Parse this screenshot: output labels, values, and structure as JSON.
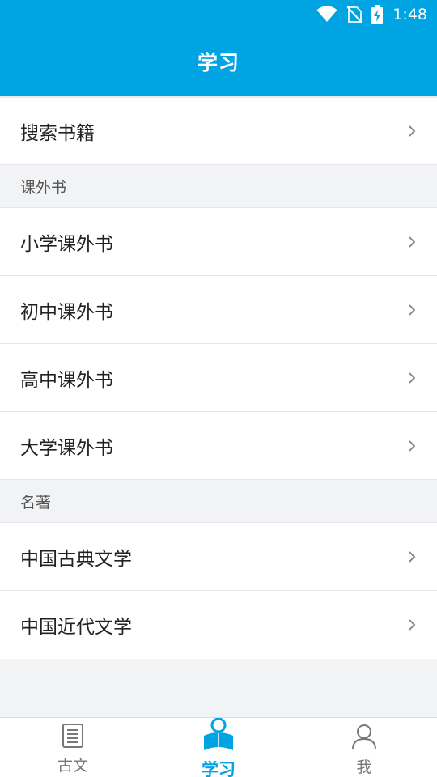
{
  "status_bar": {
    "time": "1:48"
  },
  "header": {
    "title": "学习"
  },
  "search_row": {
    "label": "搜索书籍"
  },
  "sections": [
    {
      "header": "课外书",
      "items": [
        {
          "label": "小学课外书"
        },
        {
          "label": "初中课外书"
        },
        {
          "label": "高中课外书"
        },
        {
          "label": "大学课外书"
        }
      ]
    },
    {
      "header": "名著",
      "items": [
        {
          "label": "中国古典文学"
        },
        {
          "label": "中国近代文学"
        }
      ]
    }
  ],
  "tabs": [
    {
      "label": "古文",
      "icon": "document-icon",
      "active": false
    },
    {
      "label": "学习",
      "icon": "reading-person-icon",
      "active": true
    },
    {
      "label": "我",
      "icon": "person-icon",
      "active": false
    }
  ],
  "colors": {
    "accent": "#00a4e2",
    "background": "#f2f3f5"
  }
}
